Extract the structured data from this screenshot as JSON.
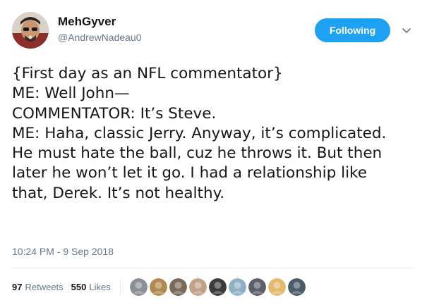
{
  "author": {
    "display_name": "MehGyver",
    "handle": "@AndrewNadeau0"
  },
  "follow_button": {
    "label": "Following",
    "color": "#1da1f2"
  },
  "tweet": {
    "text": "{First day as an NFL commentator}\nME: Well John—\nCOMMENTATOR: It’s Steve.\nME: Haha, classic Jerry. Anyway, it’s complicated. He must hate the ball, cuz he throws it. But then later he won’t let it go. I had a relationship like that, Derek. It’s not healthy.",
    "timestamp": "10:24 PM - 9 Sep 2018"
  },
  "stats": {
    "retweets_count": "97",
    "retweets_label": "Retweets",
    "likes_count": "550",
    "likes_label": "Likes"
  },
  "likers": [
    {
      "name": "liker-avatar-1",
      "color": "#8a8f96"
    },
    {
      "name": "liker-avatar-2",
      "color": "#b08a4e"
    },
    {
      "name": "liker-avatar-3",
      "color": "#7a6a5a"
    },
    {
      "name": "liker-avatar-4",
      "color": "#c2a184"
    },
    {
      "name": "liker-avatar-5",
      "color": "#3b3b3b"
    },
    {
      "name": "liker-avatar-6",
      "color": "#8fb0c4"
    },
    {
      "name": "liker-avatar-7",
      "color": "#5c5f6b"
    },
    {
      "name": "liker-avatar-8",
      "color": "#e3b96b"
    },
    {
      "name": "liker-avatar-9",
      "color": "#4a5a66"
    }
  ],
  "icons": {
    "caret": "chevron-down-icon"
  }
}
